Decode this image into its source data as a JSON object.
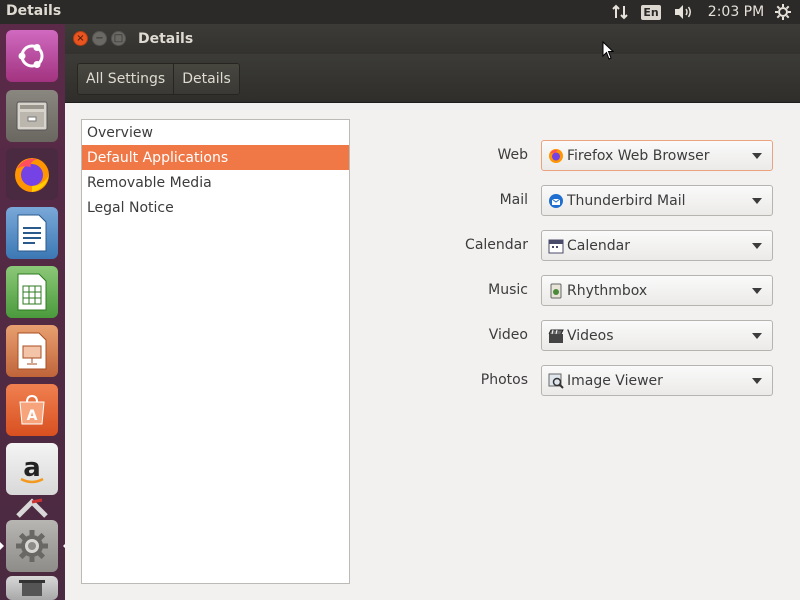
{
  "top_panel": {
    "app_title": "Details",
    "language": "En",
    "clock": "2:03 PM",
    "icons": [
      "network-icon",
      "keyboard-language-icon",
      "sound-icon",
      "system-gear-icon"
    ]
  },
  "launcher": {
    "items": [
      {
        "name": "ubuntu-dash-icon"
      },
      {
        "name": "files-icon"
      },
      {
        "name": "firefox-icon"
      },
      {
        "name": "libreoffice-writer-icon"
      },
      {
        "name": "libreoffice-calc-icon"
      },
      {
        "name": "libreoffice-impress-icon"
      },
      {
        "name": "software-center-icon"
      },
      {
        "name": "amazon-icon"
      },
      {
        "name": "system-settings-icon"
      },
      {
        "name": "trash-icon"
      }
    ]
  },
  "window": {
    "title": "Details",
    "breadcrumb": [
      "All Settings",
      "Details"
    ]
  },
  "sidebar": {
    "items": [
      "Overview",
      "Default Applications",
      "Removable Media",
      "Legal Notice"
    ],
    "selected": "Default Applications"
  },
  "default_apps": {
    "rows": [
      {
        "label": "Web",
        "value": "Firefox Web Browser",
        "icon": "firefox-icon"
      },
      {
        "label": "Mail",
        "value": "Thunderbird Mail",
        "icon": "thunderbird-icon"
      },
      {
        "label": "Calendar",
        "value": "Calendar",
        "icon": "calendar-icon"
      },
      {
        "label": "Music",
        "value": "Rhythmbox",
        "icon": "rhythmbox-icon"
      },
      {
        "label": "Video",
        "value": "Videos",
        "icon": "videos-icon"
      },
      {
        "label": "Photos",
        "value": "Image Viewer",
        "icon": "image-viewer-icon"
      }
    ]
  },
  "colors": {
    "accent": "#f07746",
    "panel": "#2b2a28",
    "launcher": "#5a2a48",
    "window_bg": "#f2f1f0"
  }
}
